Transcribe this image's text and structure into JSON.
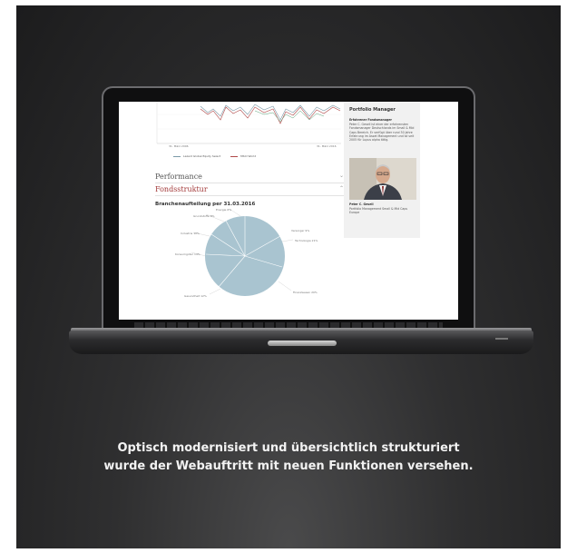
{
  "caption": {
    "line1": "Optisch modernisiert und übersichtlich strukturiert",
    "line2": "wurde der Webauftritt mit neuen Funktionen versehen."
  },
  "screen": {
    "chart_axis": {
      "x_start": "31. März 2006",
      "x_end": "31. März 2016"
    },
    "legend": {
      "series_1": "Lazard Global Equity Select",
      "series_2": "MSCI World"
    },
    "accordion": {
      "performance": "Performance",
      "fondsstruktur": "Fondsstruktur"
    },
    "section_title": "Branchenaufteilung per 31.03.2016",
    "pie_labels": [
      "Energie 6%",
      "Grundstoffe 8%",
      "Industrie 10%",
      "Konsumgüter 14%",
      "Gesundheit 12%",
      "Finanzwesen 20%",
      "Technologie 21%",
      "Versorger 9%"
    ],
    "sidebar": {
      "title": "Portfolio Manager",
      "subtitle": "Erfahrener Fondsmanager",
      "text": "Peter C. Gesell ist einer der erfahrensten Fondsmanager Deutschlands im Small & Mid Caps Bereich. Er verfügt über rund 30 Jahre Erfahrung im Asset Management und ist seit 2005 für Lupus alpha tätig.",
      "name": "Peter C. Gesell",
      "role": "Portfolio Management Small & Mid Caps Europe"
    }
  },
  "colors": {
    "accent": "#a33a3a",
    "pie": "#a9c4d0",
    "series_1": "#7b9aa8",
    "series_2": "#b04848"
  }
}
